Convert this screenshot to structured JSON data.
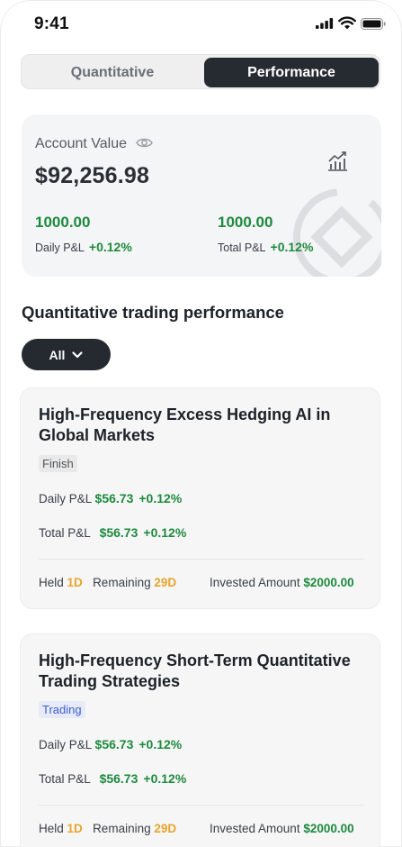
{
  "status_bar": {
    "time": "9:41"
  },
  "tabs": {
    "quantitative": "Quantitative",
    "performance": "Performance",
    "active": "Performance"
  },
  "account": {
    "label": "Account Value",
    "value": "$92,256.98",
    "daily_amount": "1000.00",
    "daily_label": "Daily P&L",
    "daily_pct": "+0.12%",
    "total_amount": "1000.00",
    "total_label": "Total P&L",
    "total_pct": "+0.12%"
  },
  "section_title": "Quantitative trading performance",
  "filter": {
    "label": "All"
  },
  "colors": {
    "accent_dark": "#262b31",
    "profit_green": "#1e8a3e",
    "highlight_orange": "#e7a52b",
    "trading_blue": "#3d5fd2"
  },
  "strategies": [
    {
      "title": "High-Frequency Excess Hedging AI in Global Markets",
      "status": "Finish",
      "daily_label": "Daily P&L",
      "daily_amount": "$56.73",
      "daily_pct": "+0.12%",
      "total_label": "Total P&L",
      "total_amount": "$56.73",
      "total_pct": "+0.12%",
      "held_label": "Held",
      "held_value": "1D",
      "remaining_label": "Remaining",
      "remaining_value": "29D",
      "invested_label": "Invested Amount",
      "invested_value": "$2000.00"
    },
    {
      "title": "High-Frequency Short-Term Quantitative Trading Strategies",
      "status": "Trading",
      "daily_label": "Daily P&L",
      "daily_amount": "$56.73",
      "daily_pct": "+0.12%",
      "total_label": "Total P&L",
      "total_amount": "$56.73",
      "total_pct": "+0.12%",
      "held_label": "Held",
      "held_value": "1D",
      "remaining_label": "Remaining",
      "remaining_value": "29D",
      "invested_label": "Invested Amount",
      "invested_value": "$2000.00"
    }
  ]
}
